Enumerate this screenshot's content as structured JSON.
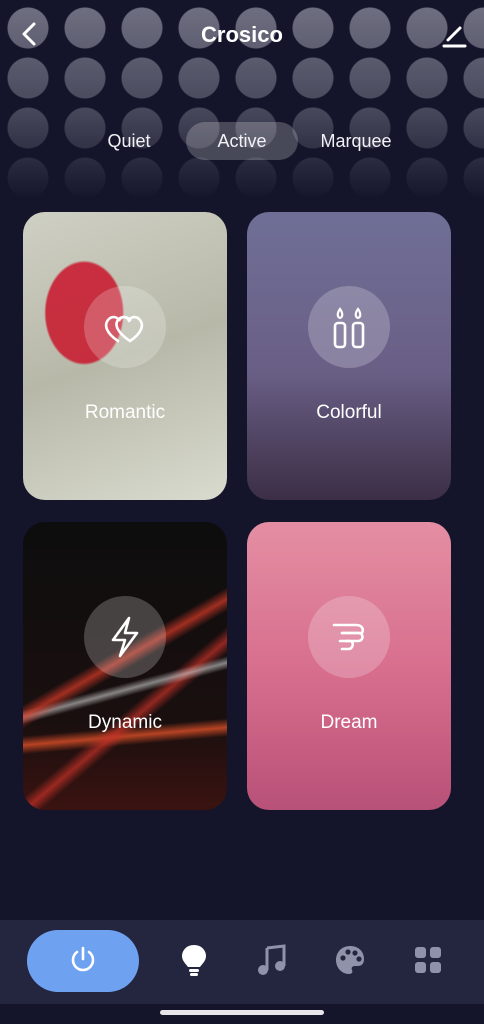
{
  "header": {
    "title": "Crosico",
    "back_icon": "chevron-left-icon",
    "edit_icon": "pencil-icon"
  },
  "tabs": [
    {
      "label": "Quiet",
      "active": false
    },
    {
      "label": "Active",
      "active": true
    },
    {
      "label": "Marquee",
      "active": false
    }
  ],
  "scenes": [
    {
      "label": "Romantic",
      "icon": "hearts-icon"
    },
    {
      "label": "Colorful",
      "icon": "candles-icon"
    },
    {
      "label": "Dynamic",
      "icon": "lightning-icon"
    },
    {
      "label": "Dream",
      "icon": "dream-icon"
    }
  ],
  "bottom_nav": {
    "items": [
      "power-icon",
      "bulb-icon",
      "music-icon",
      "palette-icon",
      "grid-icon"
    ],
    "active": "bulb-icon"
  },
  "colors": {
    "background": "#14152a",
    "bottom_bar": "#242640",
    "power_button": "#6ea2f0"
  }
}
